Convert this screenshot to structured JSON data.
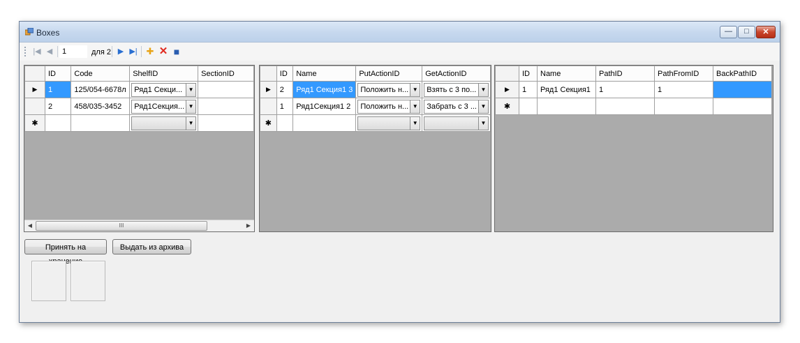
{
  "window": {
    "title": "Boxes",
    "minimize_glyph": "—",
    "maximize_glyph": "□",
    "close_glyph": "✕"
  },
  "navigator": {
    "position": "1",
    "count_label": "для 2",
    "first_glyph": "|◀",
    "prev_glyph": "◀",
    "next_glyph": "▶",
    "last_glyph": "▶|",
    "add_glyph": "✚",
    "delete_glyph": "✕",
    "save_glyph": "■",
    "add_color": "#e8a317",
    "delete_color": "#e02a1f",
    "save_color": "#2a5db0"
  },
  "grid_boxes": {
    "columns": [
      "ID",
      "Code",
      "ShelfID",
      "SectionID"
    ],
    "rows": [
      {
        "marker": "▶",
        "id": "1",
        "code": "125/054-6678л",
        "shelf": "Ряд1 Секци...",
        "section": ""
      },
      {
        "marker": "",
        "id": "2",
        "code": "458/035-3452",
        "shelf": "Ряд1Секция...",
        "section": ""
      }
    ],
    "new_row_marker": "✱",
    "scroll_left": "◀",
    "scroll_right": "▶",
    "scroll_grip": "III"
  },
  "grid_shelves": {
    "columns": [
      "ID",
      "Name",
      "PutActionID",
      "GetActionID"
    ],
    "rows": [
      {
        "marker": "▶",
        "id": "2",
        "name": "Ряд1 Секция1 3",
        "put": "Положить н...",
        "get": "Взять с 3 по..."
      },
      {
        "marker": "",
        "id": "1",
        "name": "Ряд1Секция1 2",
        "put": "Положить н...",
        "get": "Забрать с 3 ..."
      }
    ],
    "new_row_marker": "✱"
  },
  "grid_sections": {
    "columns": [
      "ID",
      "Name",
      "PathID",
      "PathFromID",
      "BackPathID"
    ],
    "rows": [
      {
        "marker": "▶",
        "id": "1",
        "name": "Ряд1 Секция1",
        "path": "1",
        "path_from": "1",
        "back_path": ""
      }
    ],
    "new_row_marker": "✱"
  },
  "buttons": {
    "accept": "Принять на хранение",
    "issue": "Выдать из архива"
  },
  "dropdown_glyph": "▼",
  "selection_color": "#3399ff"
}
